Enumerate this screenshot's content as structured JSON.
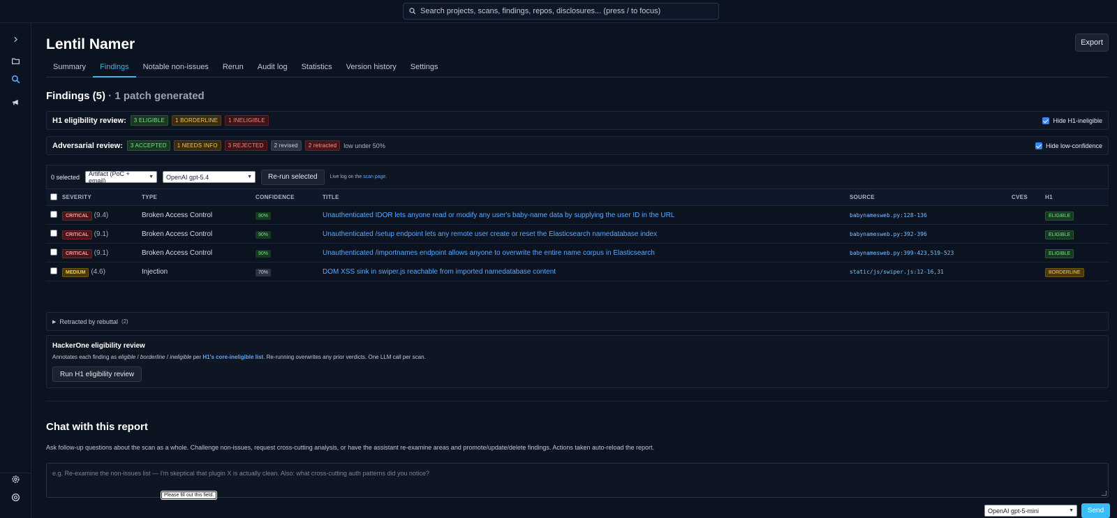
{
  "search": {
    "placeholder": "Search projects, scans, findings, repos, disclosures...  (press / to focus)"
  },
  "page": {
    "title": "Lentil Namer",
    "export_label": "Export"
  },
  "tabs": [
    {
      "label": "Summary",
      "active": false
    },
    {
      "label": "Findings",
      "active": true
    },
    {
      "label": "Notable non-issues",
      "active": false
    },
    {
      "label": "Rerun",
      "active": false
    },
    {
      "label": "Audit log",
      "active": false
    },
    {
      "label": "Statistics",
      "active": false
    },
    {
      "label": "Version history",
      "active": false
    },
    {
      "label": "Settings",
      "active": false
    }
  ],
  "findings": {
    "title": "Findings (5)",
    "subtitle": "· 1 patch generated"
  },
  "h1_review": {
    "label": "H1 eligibility review:",
    "eligible": "3 ELIGIBLE",
    "borderline": "1 BORDERLINE",
    "ineligible": "1 INELIGIBLE",
    "hide_label": "Hide H1-ineligible",
    "hide_checked": true
  },
  "adversarial": {
    "label": "Adversarial review:",
    "accepted": "3 ACCEPTED",
    "needs_info": "1 NEEDS INFO",
    "rejected": "3 REJECTED",
    "revised": "2 revised",
    "retracted": "2 retracted",
    "note": "low under 50%",
    "hide_label": "Hide low-confidence",
    "hide_checked": true
  },
  "toolbar": {
    "selected": "0 selected",
    "artifact": "Artifact (PoC + email)",
    "model": "OpenAI gpt-5.4",
    "rerun_label": "Re-run selected",
    "live_prefix": "Live log on the",
    "live_link": "scan page",
    "live_suffix": "."
  },
  "table": {
    "headers": {
      "severity": "SEVERITY",
      "type": "TYPE",
      "confidence": "CONFIDENCE",
      "title": "TITLE",
      "source": "SOURCE",
      "cves": "CVES",
      "h1": "H1"
    },
    "rows": [
      {
        "severity": "CRITICAL",
        "score": "(9.4)",
        "type": "Broken Access Control",
        "confidence": "90%",
        "title": "Unauthenticated IDOR lets anyone read or modify any user's baby-name data by supplying the user ID in the URL",
        "source": "babynamesweb.py:128-136",
        "cves": "",
        "h1": "ELIGIBLE"
      },
      {
        "severity": "CRITICAL",
        "score": "(9.1)",
        "type": "Broken Access Control",
        "confidence": "90%",
        "title": "Unauthenticated /setup endpoint lets any remote user create or reset the Elasticsearch namedatabase index",
        "source": "babynamesweb.py:392-396",
        "cves": "",
        "h1": "ELIGIBLE"
      },
      {
        "severity": "CRITICAL",
        "score": "(9.1)",
        "type": "Broken Access Control",
        "confidence": "90%",
        "title": "Unauthenticated /importnames endpoint allows anyone to overwrite the entire name corpus in Elasticsearch",
        "source": "babynamesweb.py:399-423,519-523",
        "cves": "",
        "h1": "ELIGIBLE"
      },
      {
        "severity": "MEDIUM",
        "score": "(4.6)",
        "type": "Injection",
        "confidence": "70%",
        "title": "DOM XSS sink in swiper.js reachable from imported namedatabase content",
        "source": "static/js/swiper.js:12-16,31",
        "cves": "",
        "h1": "BORDERLINE"
      }
    ]
  },
  "retracted": {
    "label": "Retracted by rebuttal",
    "count": "(2)"
  },
  "h1box": {
    "heading": "HackerOne eligibility review",
    "desc_prefix": "Annotates each finding as",
    "eligible": "eligible",
    "slash": "/",
    "borderline": "borderline",
    "ineligible": "ineligible",
    "per": "per",
    "link": "H1's core-ineligible list",
    "desc_suffix": ". Re-running overwrites any prior verdicts. One LLM call per scan.",
    "button": "Run H1 eligibility review"
  },
  "chat": {
    "title": "Chat with this report",
    "desc": "Ask follow-up questions about the scan as a whole. Challenge non-issues, request cross-cutting analysis, or have the assistant re-examine areas and promote/update/delete findings. Actions taken auto-reload the report.",
    "placeholder": "e.g. Re-examine the non-issues list — I'm skeptical that plugin X is actually clean. Also: what cross-cutting auth patterns did you notice?",
    "tooltip": "Please fill out this field.",
    "model": "OpenAI gpt-5-mini",
    "send": "Send"
  }
}
